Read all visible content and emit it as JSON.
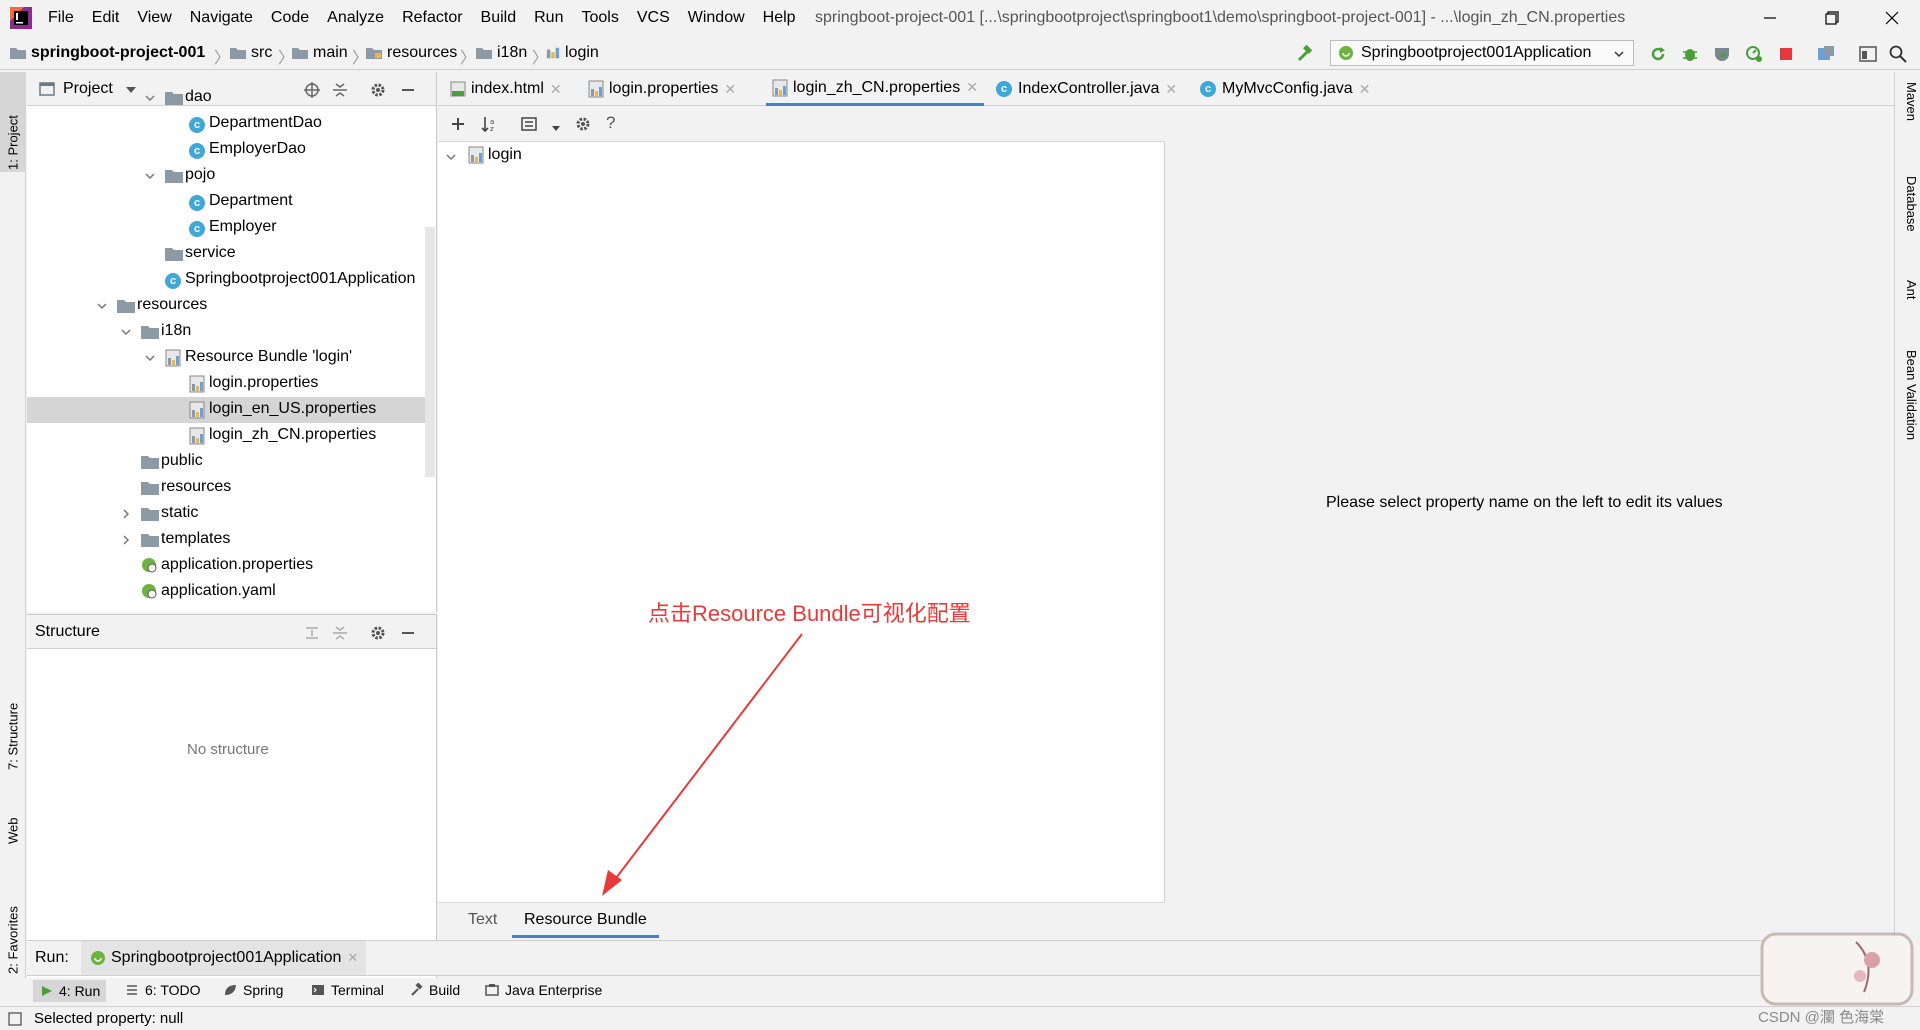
{
  "titlebar": {
    "menu": [
      "File",
      "Edit",
      "View",
      "Navigate",
      "Code",
      "Analyze",
      "Refactor",
      "Build",
      "Run",
      "Tools",
      "VCS",
      "Window",
      "Help"
    ],
    "title": "springboot-project-001 [...\\springbootproject\\springboot1\\demo\\springboot-project-001] - ...\\login_zh_CN.properties"
  },
  "navbar": {
    "breadcrumbs": [
      "springboot-project-001",
      "src",
      "main",
      "resources",
      "i18n",
      "login"
    ],
    "run_config": "Springbootproject001Application"
  },
  "left_strip": {
    "tabs": [
      "1: Project",
      "7: Structure",
      "Web",
      "2: Favorites"
    ]
  },
  "right_strip": {
    "tabs": [
      "Maven",
      "Database",
      "Ant",
      "Bean Validation"
    ]
  },
  "project_panel": {
    "header": "Project",
    "tree": [
      {
        "label": "dao",
        "type": "folder",
        "indent": 2,
        "expanded": true
      },
      {
        "label": "DepartmentDao",
        "type": "class",
        "indent": 3
      },
      {
        "label": "EmployerDao",
        "type": "class",
        "indent": 3
      },
      {
        "label": "pojo",
        "type": "folder",
        "indent": 2,
        "expanded": true
      },
      {
        "label": "Department",
        "type": "class",
        "indent": 3
      },
      {
        "label": "Employer",
        "type": "class",
        "indent": 3
      },
      {
        "label": "service",
        "type": "folder",
        "indent": 2
      },
      {
        "label": "Springbootproject001Application",
        "type": "spring",
        "indent": 2
      },
      {
        "label": "resources",
        "type": "folder",
        "indent": 0,
        "expanded": true
      },
      {
        "label": "i18n",
        "type": "folder",
        "indent": 1,
        "expanded": true
      },
      {
        "label": "Resource Bundle 'login'",
        "type": "bundle",
        "indent": 2,
        "expanded": true
      },
      {
        "label": "login.properties",
        "type": "props",
        "indent": 3
      },
      {
        "label": "login_en_US.properties",
        "type": "props",
        "indent": 3,
        "selected": true
      },
      {
        "label": "login_zh_CN.properties",
        "type": "props",
        "indent": 3
      },
      {
        "label": "public",
        "type": "folder",
        "indent": 1
      },
      {
        "label": "resources",
        "type": "folder",
        "indent": 1
      },
      {
        "label": "static",
        "type": "folder",
        "indent": 1,
        "collapsed": true
      },
      {
        "label": "templates",
        "type": "folder",
        "indent": 1,
        "collapsed": true
      },
      {
        "label": "application.properties",
        "type": "appprops",
        "indent": 1
      },
      {
        "label": "application.yaml",
        "type": "appprops",
        "indent": 1
      }
    ]
  },
  "structure_panel": {
    "header": "Structure",
    "empty_text": "No structure"
  },
  "editor": {
    "tabs": [
      {
        "label": "index.html",
        "icon": "html-icon"
      },
      {
        "label": "login.properties",
        "icon": "properties-icon"
      },
      {
        "label": "login_zh_CN.properties",
        "icon": "properties-icon",
        "active": true
      },
      {
        "label": "IndexController.java",
        "icon": "class-icon"
      },
      {
        "label": "MyMvcConfig.java",
        "icon": "class-icon"
      }
    ],
    "bundle_root": "login",
    "value_hint": "Please select property name on the left to edit its values",
    "bottom_tabs": [
      "Text",
      "Resource Bundle"
    ],
    "annotation": "点击Resource Bundle可视化配置"
  },
  "run_bar": {
    "label": "Run:",
    "config": "Springbootproject001Application"
  },
  "tool_windows": [
    "4: Run",
    "6: TODO",
    "Spring",
    "Terminal",
    "Build",
    "Java Enterprise"
  ],
  "status": {
    "text": "Selected property: null"
  },
  "watermark": {
    "text": "CSDN @瀾 色海棠"
  },
  "colors": {
    "accent": "#4083c9",
    "annotation": "#e83a3a",
    "class_icon": "#40a8d8"
  }
}
